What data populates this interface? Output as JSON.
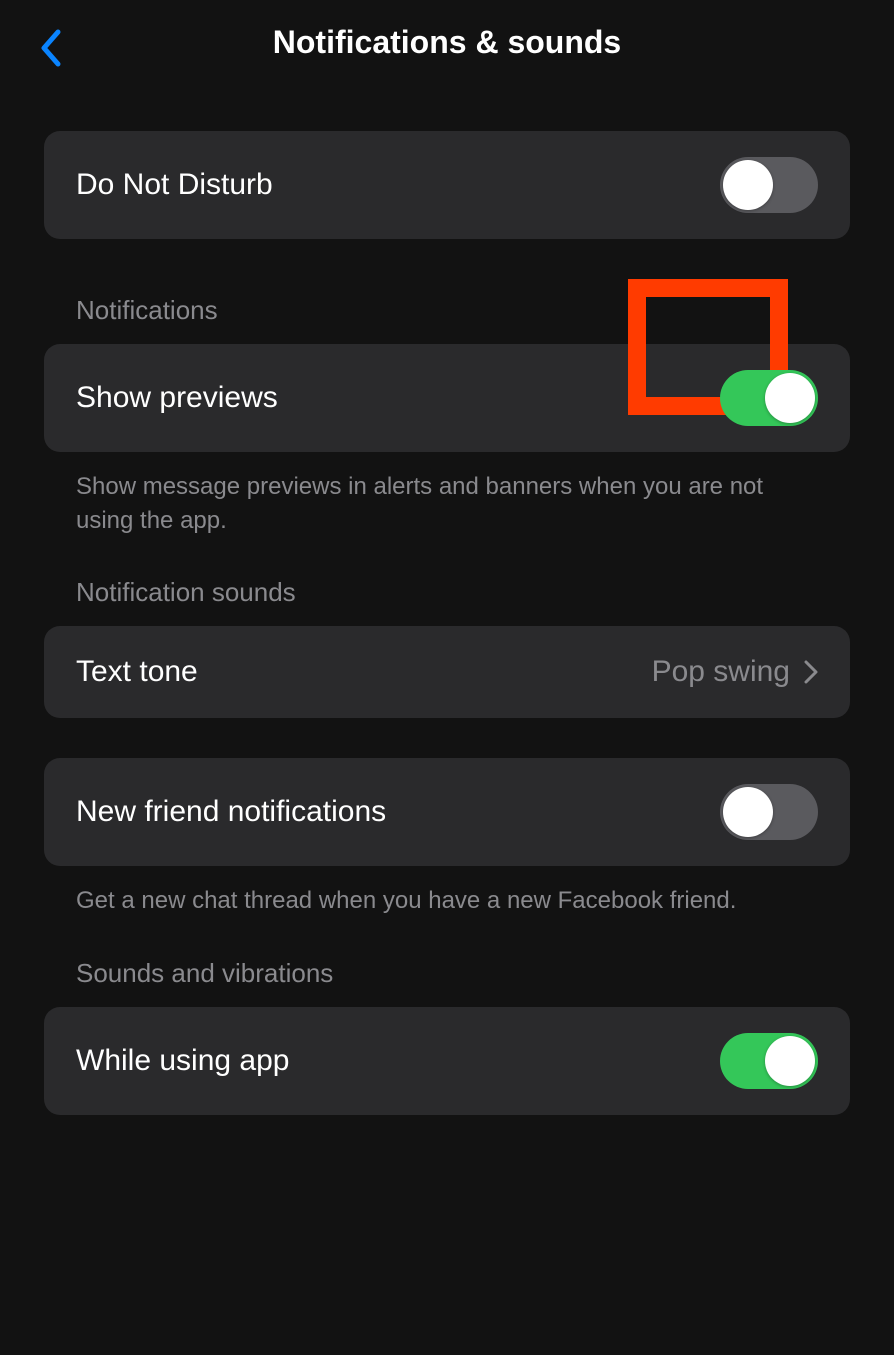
{
  "header": {
    "title": "Notifications & sounds"
  },
  "dnd": {
    "label": "Do Not Disturb",
    "on": false
  },
  "notifications": {
    "header": "Notifications",
    "show_previews_label": "Show previews",
    "show_previews_on": true,
    "footer": "Show message previews in alerts and banners when you are not using the app."
  },
  "notification_sounds": {
    "header": "Notification sounds",
    "text_tone_label": "Text tone",
    "text_tone_value": "Pop swing"
  },
  "new_friend": {
    "label": "New friend notifications",
    "on": false,
    "footer": "Get a new chat thread when you have a new Facebook friend."
  },
  "sounds_vibrations": {
    "header": "Sounds and vibrations",
    "while_using_label": "While using app",
    "while_using_on": true
  }
}
